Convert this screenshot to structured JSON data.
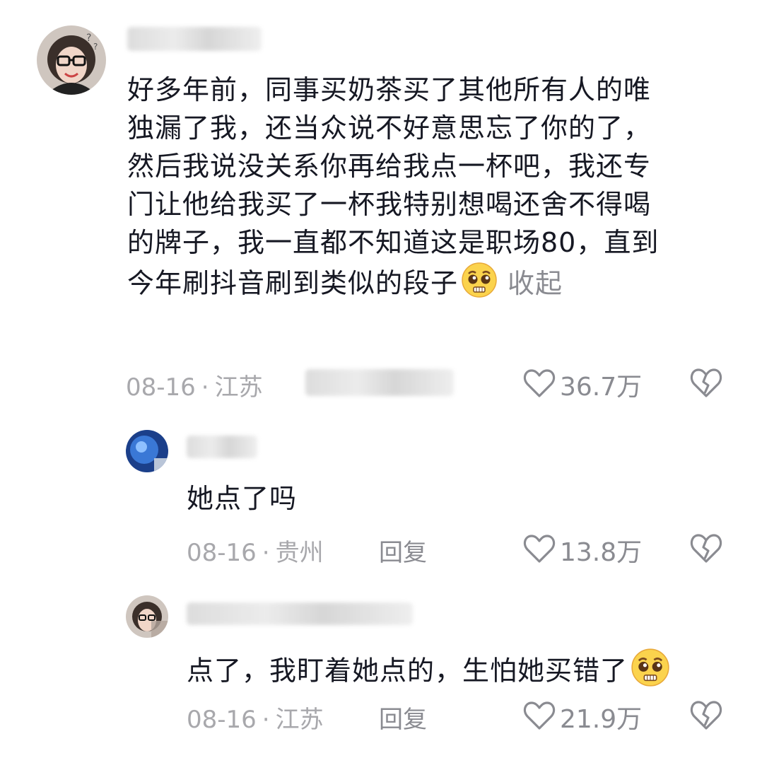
{
  "comments": [
    {
      "lines": [
        "好多年前，同事买奶茶买了其他所有人的唯",
        "独漏了我，还当众说不好意思忘了你的了，",
        "然后我说没关系你再给我点一杯吧，我还专",
        "门让他给我买了一杯我特别想喝还舍不得喝",
        "的牌子，我一直都不知道这是职场80，直到",
        "今年刷抖音刷到类似的段子"
      ],
      "collapse_label": "收起",
      "date": "08-16",
      "location": "江苏",
      "likes": "36.7万",
      "emoji_icon": "pleading-face-icon"
    },
    {
      "text": "她点了吗",
      "date": "08-16",
      "location": "贵州",
      "reply_label": "回复",
      "likes": "13.8万"
    },
    {
      "text": "点了，我盯着她点的，生怕她买错了",
      "date": "08-16",
      "location": "江苏",
      "reply_label": "回复",
      "likes": "21.9万",
      "emoji_icon": "pleading-face-icon"
    }
  ],
  "separator": "·",
  "icons": {
    "like": "heart-outline-icon",
    "dislike": "broken-heart-icon"
  },
  "colors": {
    "text": "#161823",
    "meta": "#a8a8ac",
    "action": "#8a8b91"
  }
}
